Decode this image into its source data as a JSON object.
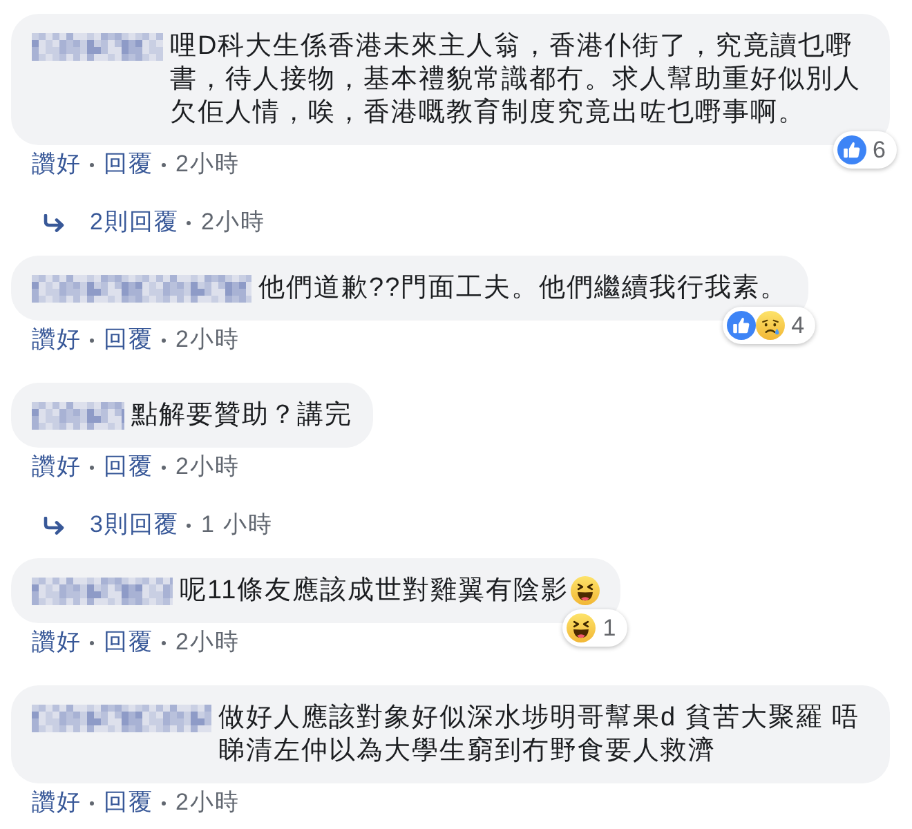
{
  "thread": [
    {
      "kind": "comment",
      "text": "哩D科大生係香港未來主人翁，香港仆街了，究竟讀乜嘢書，待人接物，基本禮貌常識都冇。求人幫助重好似別人欠佢人情，唉，香港嘅教育制度究竟出咗乜嘢事啊。",
      "reactions": {
        "items": [
          {
            "kind": "like"
          }
        ],
        "count": "6"
      },
      "like_link": "讚好",
      "reply_link": "回覆",
      "time": "2小時"
    },
    {
      "kind": "replies",
      "label": "2則回覆",
      "time": "2小時"
    },
    {
      "kind": "comment",
      "text": "他們道歉??門面工夫。他們繼續我行我素。",
      "reactions": {
        "items": [
          {
            "kind": "like"
          },
          {
            "kind": "sad"
          }
        ],
        "count": "4"
      },
      "like_link": "讚好",
      "reply_link": "回覆",
      "time": "2小時"
    },
    {
      "kind": "comment",
      "text": "點解要贊助？講完",
      "like_link": "讚好",
      "reply_link": "回覆",
      "time": "2小時"
    },
    {
      "kind": "replies",
      "label": "3則回覆",
      "time": "1 小時"
    },
    {
      "kind": "comment",
      "text": "呢11條友應該成世對雞翼有陰影",
      "trailing_emoji": {
        "kind": "haha"
      },
      "reactions": {
        "items": [
          {
            "kind": "haha"
          }
        ],
        "count": "1"
      },
      "like_link": "讚好",
      "reply_link": "回覆",
      "time": "2小時"
    },
    {
      "kind": "comment",
      "text": "做好人應該對象好似深水埗明哥幫果d 貧苦大聚羅 唔睇清左仲以為大學生窮到冇野食要人救濟",
      "like_link": "讚好",
      "reply_link": "回覆",
      "time": "2小時"
    }
  ]
}
